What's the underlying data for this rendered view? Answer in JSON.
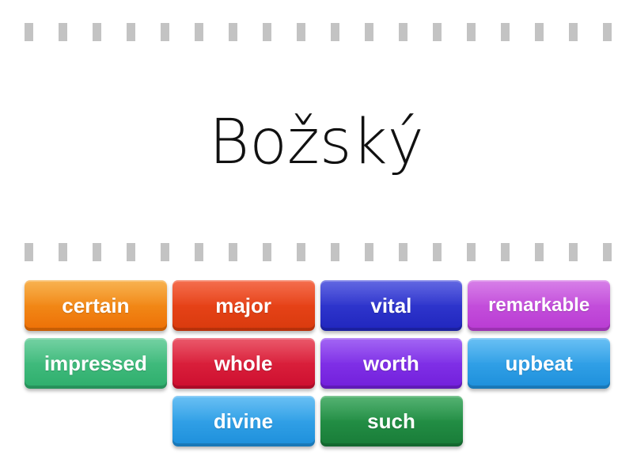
{
  "page": {
    "title_word": "Božský",
    "background_color": "#ffffff"
  },
  "separators": {
    "dash_color": "#c3c3c3",
    "dash_count_top": 19,
    "dash_count_bottom": 19,
    "name_top": "perforation-row-top",
    "name_bottom": "perforation-row-bottom"
  },
  "tiles": {
    "rows": [
      [
        {
          "label": "certain",
          "color_top": "#f6a026",
          "color_bottom": "#ed6f06"
        },
        {
          "label": "major",
          "color_top": "#f24a22",
          "color_bottom": "#d93a0d"
        },
        {
          "label": "vital",
          "color_top": "#3c43db",
          "color_bottom": "#2026bd"
        },
        {
          "label": "remarkable",
          "color_top": "#cd60e2",
          "color_bottom": "#b93bd3"
        }
      ],
      [
        {
          "label": "impressed",
          "color_top": "#51c68c",
          "color_bottom": "#2eae6c"
        },
        {
          "label": "whole",
          "color_top": "#e53046",
          "color_bottom": "#cd0e2f"
        },
        {
          "label": "worth",
          "color_top": "#8c40f1",
          "color_bottom": "#721fdb"
        },
        {
          "label": "upbeat",
          "color_top": "#44b0f1",
          "color_bottom": "#1d8fdb"
        }
      ],
      [
        {
          "label": "divine",
          "color_top": "#44b0f1",
          "color_bottom": "#1d8fdb"
        },
        {
          "label": "such",
          "color_top": "#2ba050",
          "color_bottom": "#197b38"
        }
      ]
    ]
  }
}
